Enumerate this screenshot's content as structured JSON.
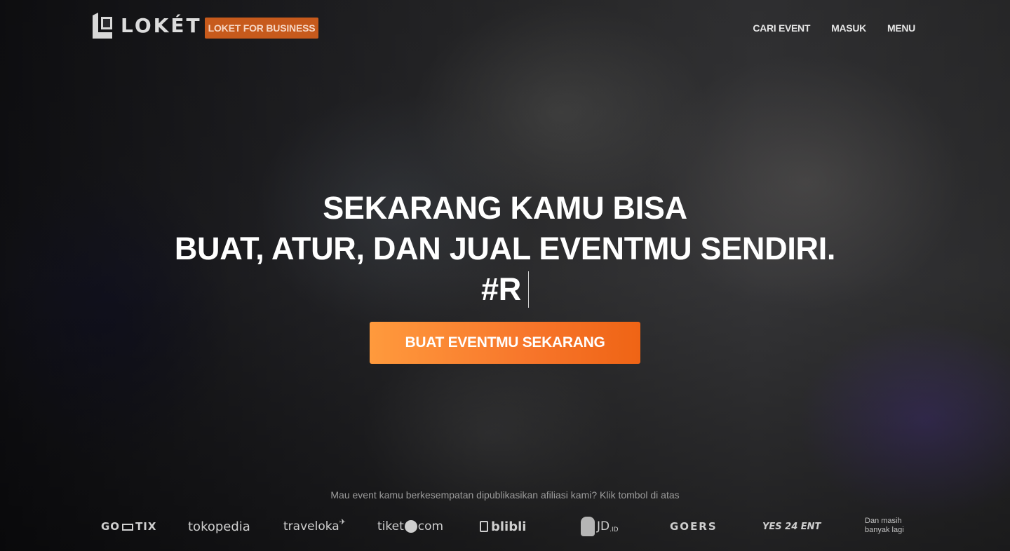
{
  "header": {
    "logo_text": "LOKÉT",
    "business_button": "LOKET FOR BUSINESS",
    "nav": [
      {
        "label": "CARI EVENT"
      },
      {
        "label": "MASUK"
      },
      {
        "label": "MENU"
      }
    ]
  },
  "hero": {
    "line1": "SEKARANG KAMU BISA",
    "line2": "BUAT, ATUR, DAN JUAL EVENTMU SENDIRI.",
    "typed_text": "#R",
    "cta_label": "BUAT EVENTMU SEKARANG",
    "accent_color": "#f7752a"
  },
  "partners": {
    "note": "Mau event kamu berkesempatan dipublikasikan afiliasi kami? Klik tombol di atas",
    "logos": {
      "gotix_left": "GO",
      "gotix_right": "TIX",
      "tokopedia": "tokopedia",
      "traveloka": "traveloka",
      "tiket_left": "tiket",
      "tiket_right": "com",
      "blibli": "blibli",
      "jd": "JD",
      "jd_suffix": ".ID",
      "goers": "GOERS",
      "yes24": "YES 24 ENT"
    },
    "more_line1": "Dan masih",
    "more_line2": "banyak lagi"
  }
}
